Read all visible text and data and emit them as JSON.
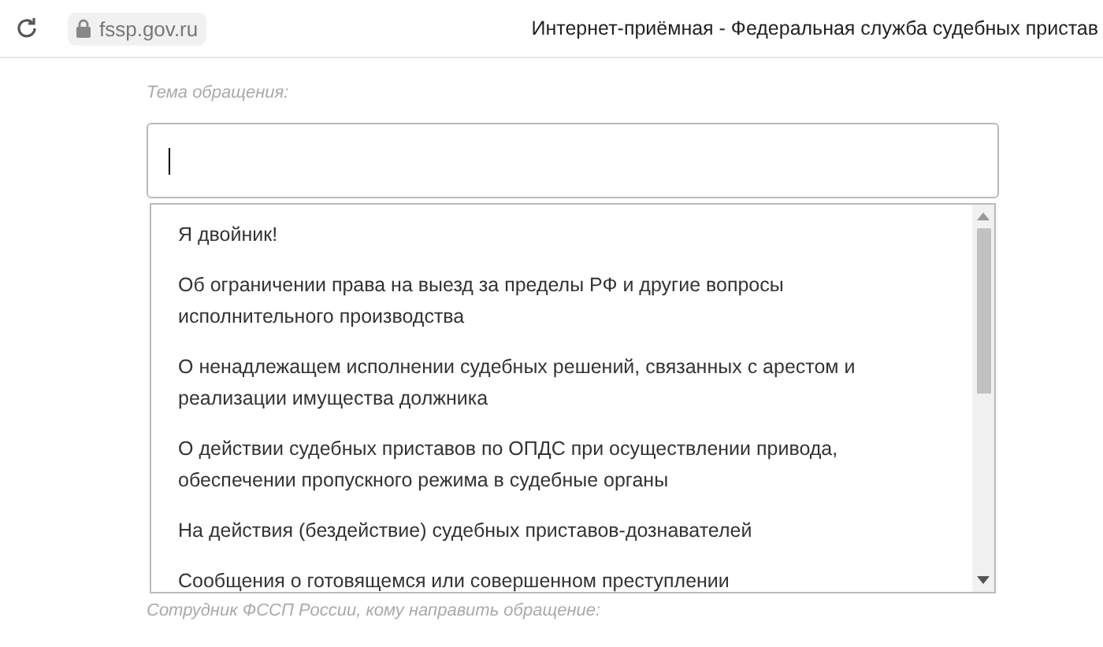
{
  "browser": {
    "url": "fssp.gov.ru",
    "title": "Интернет-приёмная - Федеральная служба судебных пристав"
  },
  "form": {
    "topic_label": "Тема обращения:",
    "dropdown_options": [
      {
        "label": "Я двойник!",
        "selected": false
      },
      {
        "label": "Об ограничении права на выезд за пределы РФ и другие вопросы исполнительного производства",
        "selected": false
      },
      {
        "label": "О ненадлежащем исполнении судебных решений, связанных с арестом и реализации имущества должника",
        "selected": false
      },
      {
        "label": "О действии судебных приставов по ОПДС при осуществлении привода, обеспечении пропускного режима в судебные органы",
        "selected": false
      },
      {
        "label": "На действия (бездействие) судебных приставов-дознавателей",
        "selected": false
      },
      {
        "label": "Сообщения о готовящемся или совершенном преступлении",
        "selected": false
      }
    ],
    "employee_label": "Сотрудник ФССП России, кому направить обращение:"
  }
}
